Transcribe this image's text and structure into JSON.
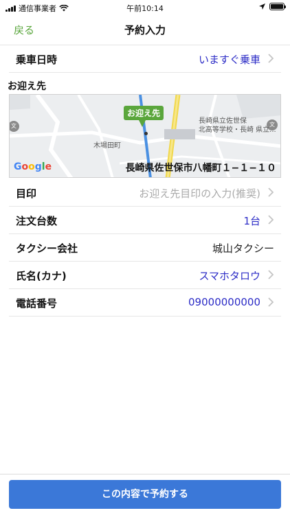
{
  "status_bar": {
    "carrier": "通信事業者",
    "time": "午前10:14",
    "battery_level": 1.0
  },
  "nav": {
    "back_label": "戻る",
    "title": "予約入力"
  },
  "ride_time": {
    "label": "乗車日時",
    "value": "いますぐ乗車"
  },
  "pickup": {
    "section_label": "お迎え先",
    "pin_label": "お迎え先",
    "address": "長崎県佐世保市八幡町１−１−１０",
    "map_places": {
      "school_line1": "長崎県立佐世保",
      "school_line2": "北高等学校・長崎 県立...",
      "town": "木場田町"
    },
    "map_badge": "文"
  },
  "landmark": {
    "label": "目印",
    "placeholder": "お迎え先目印の入力(推奨)"
  },
  "car_count": {
    "label": "注文台数",
    "value": "1台"
  },
  "taxi_company": {
    "label": "タクシー会社",
    "value": "城山タクシー"
  },
  "name_kana": {
    "label": "氏名(カナ)",
    "value": "スマホタロウ"
  },
  "phone": {
    "label": "電話番号",
    "value": "09000000000"
  },
  "submit": {
    "label": "この内容で予約する"
  },
  "colors": {
    "accent_green": "#5aa63c",
    "value_blue": "#2b2bc6",
    "button_blue": "#3b78d8"
  }
}
